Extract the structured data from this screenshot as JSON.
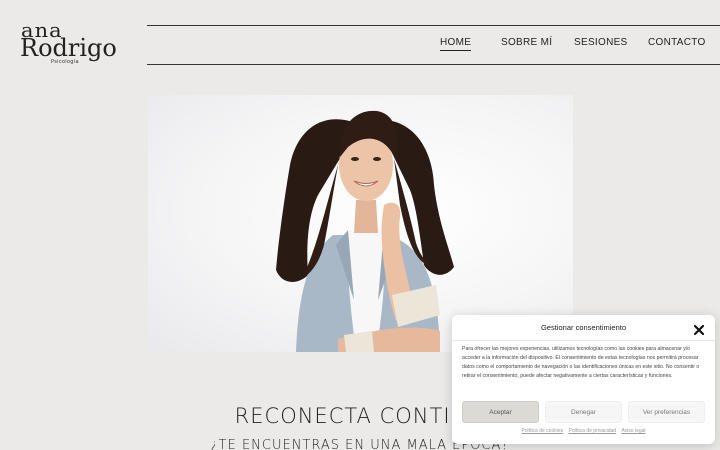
{
  "logo": {
    "line1": "ana",
    "line2": "Rodrigo",
    "line3": "Psicología"
  },
  "nav": {
    "items": [
      "HOME",
      "SOBRE MÍ",
      "SESIONES",
      "CONTACTO"
    ]
  },
  "hero": {
    "headline": "RECONECTA CONTIGO",
    "subheadline": "¿TE ENCUENTRAS EN UNA MALA ÉPOCA?"
  },
  "cookie": {
    "title": "Gestionar consentimiento",
    "text": "Para ofrecer las mejores experiencias, utilizamos tecnologías como las cookies para almacenar y/o acceder a la información del dispositivo. El consentimiento de estas tecnologías nos permitirá procesar datos como el comportamiento de navegación o las identificaciones únicas en este sitio. No consentir o retirar el consentimiento, puede afectar negativamente a ciertas características y funciones.",
    "accept": "Aceptar",
    "deny": "Denegar",
    "prefs": "Ver preferencias",
    "links": [
      "Política de cookies",
      "Política de privacidad",
      "Aviso legal"
    ]
  },
  "colors": {
    "background": "#ebeae8",
    "accept_button": "#dcdad5"
  }
}
